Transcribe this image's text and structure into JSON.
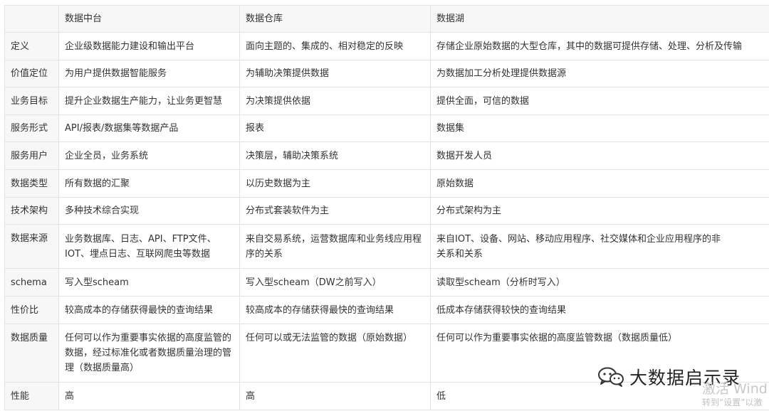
{
  "table": {
    "headers": [
      "",
      "数据中台",
      "数据仓库",
      "数据湖"
    ],
    "rows": [
      [
        "定义",
        "企业级数据能力建设和输出平台",
        "面向主题的、集成的、相对稳定的反映",
        "存储企业原始数据的大型仓库，其中的数据可提供存储、处理、分析及传输"
      ],
      [
        "价值定位",
        "为用户提供数据智能服务",
        "为辅助决策提供数据",
        "为数据加工分析处理提供数据源"
      ],
      [
        "业务目标",
        "提升企业数据生产能力，让业务更智慧",
        "为决策提供依据",
        "提供全面，可信的数据"
      ],
      [
        "服务形式",
        "API/报表/数据集等数据产品",
        "报表",
        "数据集"
      ],
      [
        "服务用户",
        "企业全员，业务系统",
        "决策层，辅助决策系统",
        "数据开发人员"
      ],
      [
        "数据类型",
        "所有数据的汇聚",
        "以历史数据为主",
        "原始数据"
      ],
      [
        "技术架构",
        "多种技术综合实现",
        "分布式套装软件为主",
        "分布式架构为主"
      ],
      [
        "数据来源",
        "业务数据库、日志、API、FTP文件、IOT、埋点日志、互联网爬虫等数据",
        "来自交易系统，运营数据库和业务线应用程序的关系",
        "来自IOT、设备、网站、移动应用程序、社交媒体和企业应用程序的非关系和关系"
      ],
      [
        "schema",
        "写入型scheam",
        "写入型scheam（DW之前写入）",
        "读取型scheam（分析时写入）"
      ],
      [
        "性价比",
        "较高成本的存储获得最快的查询结果",
        "较高成本的存储获得最快的查询结果",
        "低成本存储获得较快的查询结果"
      ],
      [
        "数据质量",
        "任何可以作为重要事实依据的高度监管的数据，经过标准化或者数据质量治理的管理（数据质量高）",
        "任何可以或无法监管的数据（原始数据）",
        "任何可以作为重要事实依据的高度监管数据（数据质量低）"
      ],
      [
        "性能",
        "高",
        "高",
        "低"
      ]
    ]
  },
  "watermark": {
    "text": "大数据启示录",
    "icon": "wechat-icon"
  },
  "activation_overlay": {
    "title": "激活 Wind",
    "subtitle": "转到“设置”以激"
  },
  "colors": {
    "text": "#333333",
    "border": "#e3e3e3",
    "header_bg": "#f7f7f7",
    "watermark": "#111111",
    "overlay": "#c8c8c8"
  }
}
